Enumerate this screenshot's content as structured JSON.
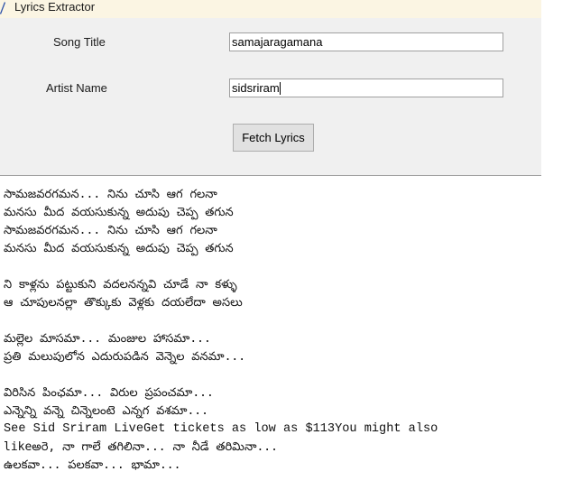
{
  "window": {
    "title": "Lyrics Extractor"
  },
  "form": {
    "song_title_label": "Song Title",
    "song_title_value": "samajaragamana",
    "artist_name_label": "Artist Name",
    "artist_name_value": "sidsriram",
    "fetch_button_label": "Fetch Lyrics"
  },
  "lyrics": {
    "lines": [
      "సామజవరగమన... నిను చూసి ఆగ గలనా",
      "మనసు మీద వయసుకున్న అదుపు చెప్ప తగున",
      "సామజవరగమన... నిను చూసి ఆగ గలనా",
      "మనసు మీద వయసుకున్న అదుపు చెప్ప తగున",
      "",
      "ని కాళ్లను పట్టుకుని వదలనన్నవి చూడే నా కళ్ళు",
      "ఆ చూపులనల్లా తొక్కుకు వెళ్లకు దయలేదా అసలు",
      "",
      "మల్లెల మాసమా... మంజుల హాసమా...",
      "ప్రతి మలుపులోన ఎదురుపడిన వెన్నెల వనమా...",
      "",
      "విరిసిన పింఛమా... విరుల ప్రపంచమా...",
      "ఎన్నెన్ని వన్నె చిన్నెలంటె ఎన్నగ వశమా...",
      "See Sid Sriram LiveGet tickets as low as $113You might also",
      "likeఅరె, నా గాలే తగిలినా... నా నీడే తరిమినా...",
      "ఉలకవా... పలకవా... భామా..."
    ]
  },
  "colors": {
    "titlebar_bg": "#fbf5e3",
    "window_bg": "#f0f0f0",
    "icon": "#2a4fa8"
  }
}
